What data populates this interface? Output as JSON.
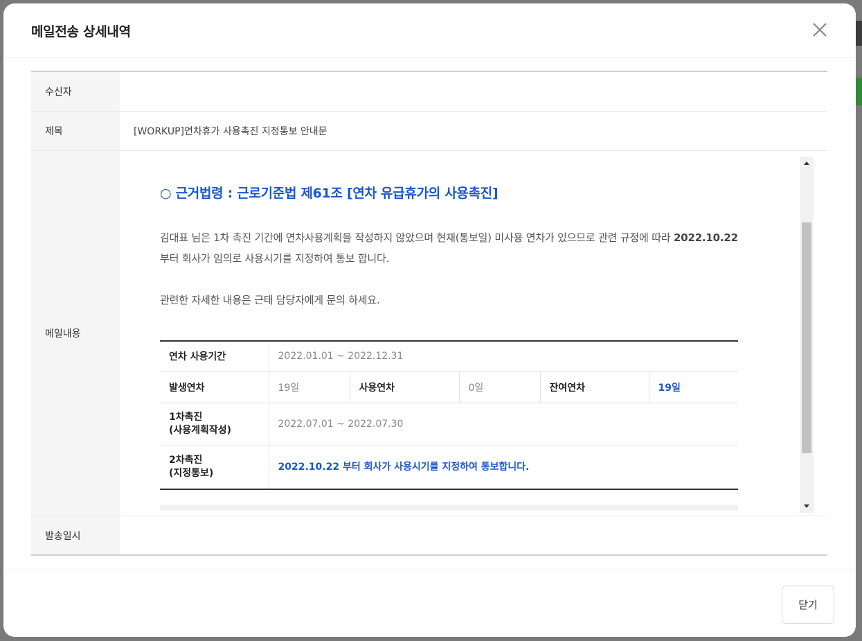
{
  "modal": {
    "title": "메일전송 상세내역",
    "close_button_label": "닫기"
  },
  "rows": {
    "recipient_label": "수신자",
    "recipient_value": "",
    "subject_label": "제목",
    "subject_value": "[WORKUP]연차휴가 사용촉진 지정통보 안내문",
    "content_label": "메일내용",
    "sent_label": "발송일시",
    "sent_value": ""
  },
  "mail": {
    "legal_title": "○ 근거법령 : 근로기준법 제61조 [연차 유급휴가의 사용촉진]",
    "para1_before": "김대표 님은 1차 촉진 기간에 연차사용계획을 작성하지 않았으며 현재(통보일) 미사용 연차가 있으므로 관련 규정에 따라 ",
    "para1_date": "2022.10.22",
    "para1_after": " 부터 회사가 임의로 사용시기를 지정하여 통보 합니다.",
    "para2": "관련한 자세한 내용은 근태 담당자에게 문의 하세요.",
    "table": {
      "period_label": "연차 사용기간",
      "period_value": "2022.01.01 ~ 2022.12.31",
      "occurred_label": "발생연차",
      "occurred_value": "19일",
      "used_label": "사용연차",
      "used_value": "0일",
      "remaining_label": "잔여연차",
      "remaining_value": "19일",
      "first_label_1": "1차촉진",
      "first_label_2": "(사용계획작성)",
      "first_value": "2022.07.01 ~ 2022.07.30",
      "second_label_1": "2차촉진",
      "second_label_2": "(지정통보)",
      "second_value": "2022.10.22 부터 회사가 사용시기를 지정하여 통보합니다."
    }
  },
  "colors": {
    "accent_blue": "#1a56c8"
  }
}
